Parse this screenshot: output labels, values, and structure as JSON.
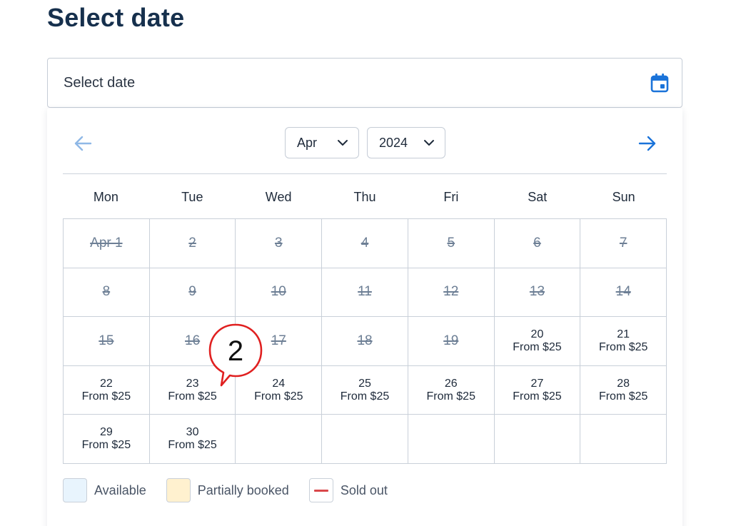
{
  "header": {
    "title": "Select date"
  },
  "date_input": {
    "label": "Select date",
    "icon": "calendar-icon"
  },
  "nav": {
    "prev_icon": "arrow-left-icon",
    "next_icon": "arrow-right-icon",
    "month": "Apr",
    "year": "2024"
  },
  "weekdays": [
    "Mon",
    "Tue",
    "Wed",
    "Thu",
    "Fri",
    "Sat",
    "Sun"
  ],
  "weeks": [
    [
      {
        "label": "Apr 1",
        "status": "past"
      },
      {
        "label": "2",
        "status": "past"
      },
      {
        "label": "3",
        "status": "past"
      },
      {
        "label": "4",
        "status": "past"
      },
      {
        "label": "5",
        "status": "past"
      },
      {
        "label": "6",
        "status": "past"
      },
      {
        "label": "7",
        "status": "past"
      }
    ],
    [
      {
        "label": "8",
        "status": "past"
      },
      {
        "label": "9",
        "status": "past"
      },
      {
        "label": "10",
        "status": "past"
      },
      {
        "label": "11",
        "status": "past"
      },
      {
        "label": "12",
        "status": "past"
      },
      {
        "label": "13",
        "status": "past"
      },
      {
        "label": "14",
        "status": "past"
      }
    ],
    [
      {
        "label": "15",
        "status": "past"
      },
      {
        "label": "16",
        "status": "past"
      },
      {
        "label": "17",
        "status": "past"
      },
      {
        "label": "18",
        "status": "past"
      },
      {
        "label": "19",
        "status": "past"
      },
      {
        "label": "20",
        "status": "available",
        "price": "From $25"
      },
      {
        "label": "21",
        "status": "available",
        "price": "From $25"
      }
    ],
    [
      {
        "label": "22",
        "status": "available",
        "price": "From $25"
      },
      {
        "label": "23",
        "status": "available",
        "price": "From $25"
      },
      {
        "label": "24",
        "status": "available",
        "price": "From $25"
      },
      {
        "label": "25",
        "status": "available",
        "price": "From $25"
      },
      {
        "label": "26",
        "status": "available",
        "price": "From $25"
      },
      {
        "label": "27",
        "status": "available",
        "price": "From $25"
      },
      {
        "label": "28",
        "status": "available",
        "price": "From $25"
      }
    ],
    [
      {
        "label": "29",
        "status": "available",
        "price": "From $25"
      },
      {
        "label": "30",
        "status": "available",
        "price": "From $25"
      },
      {
        "label": "",
        "status": "empty"
      },
      {
        "label": "",
        "status": "empty"
      },
      {
        "label": "",
        "status": "empty"
      },
      {
        "label": "",
        "status": "empty"
      },
      {
        "label": "",
        "status": "empty"
      }
    ]
  ],
  "legend": [
    {
      "label": "Available",
      "type": "available"
    },
    {
      "label": "Partially booked",
      "type": "partial"
    },
    {
      "label": "Sold out",
      "type": "sold"
    }
  ],
  "annotation": {
    "text": "2",
    "color": "#e02020"
  },
  "colors": {
    "title": "#16304d",
    "accent": "#1a73d9",
    "available_bg": "#e8f4fd",
    "partial_bg": "#fff1cf",
    "price": "#3f8a2a",
    "sold_out": "#d9474a"
  }
}
